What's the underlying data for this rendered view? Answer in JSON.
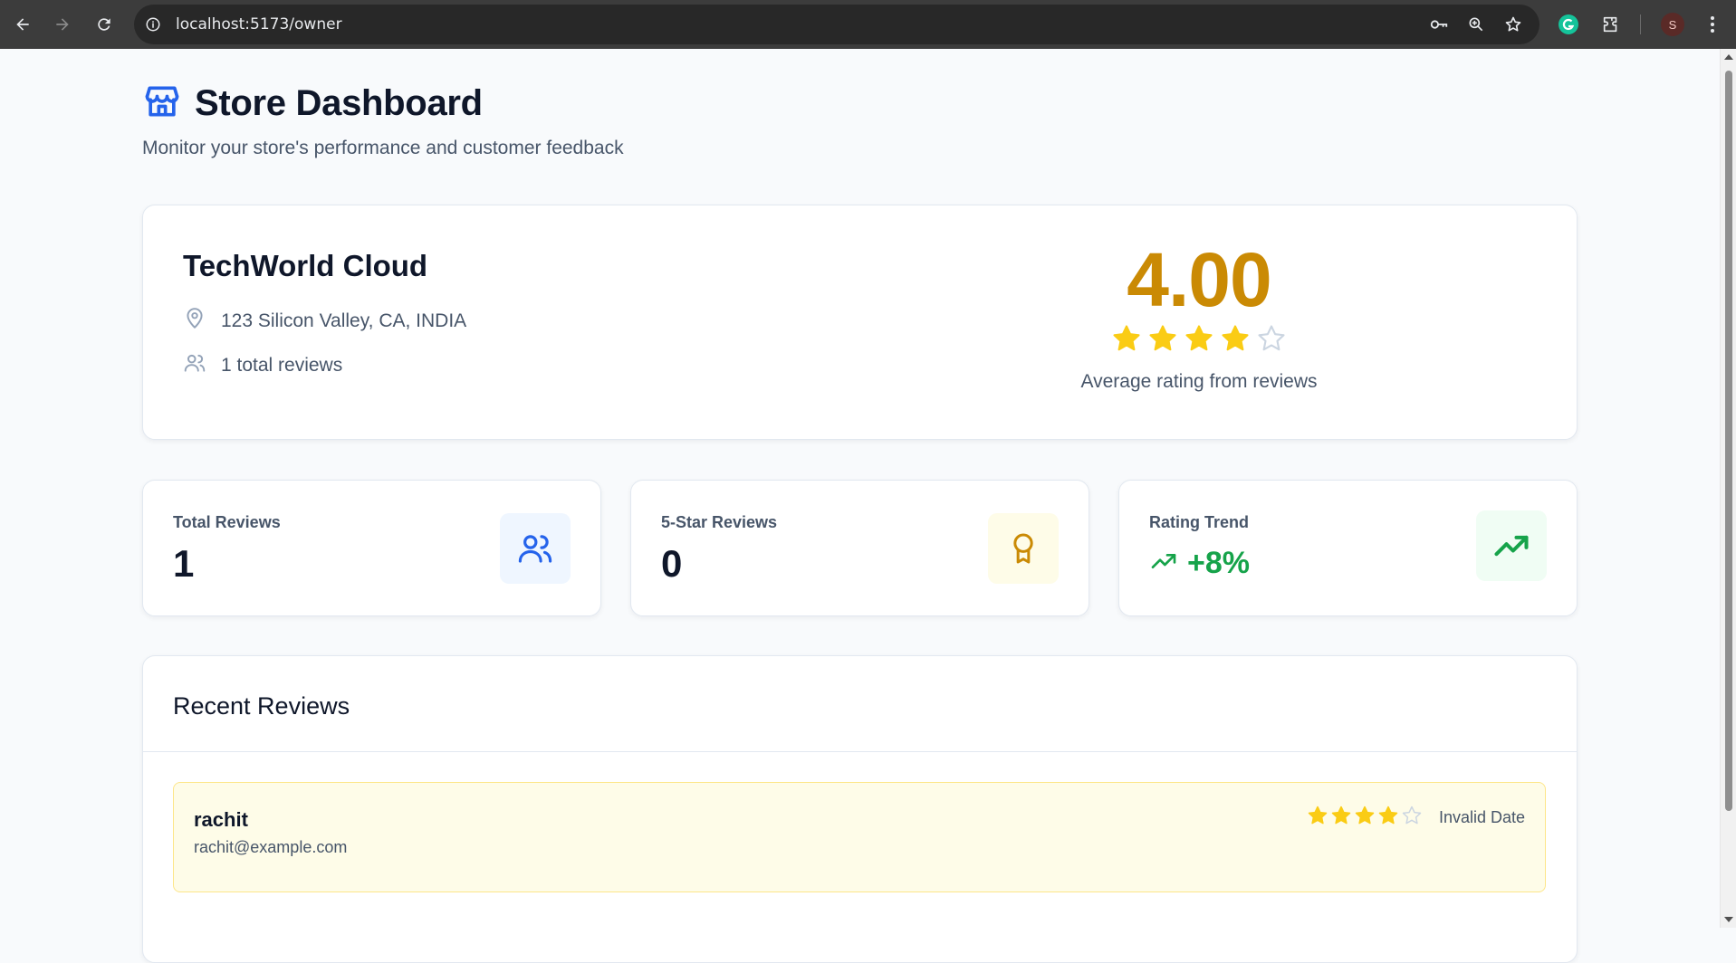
{
  "browser": {
    "url": "localhost:5173/owner",
    "profile_initial": "S"
  },
  "header": {
    "title": "Store Dashboard",
    "subtitle": "Monitor your store's performance and customer feedback",
    "icon": "store-icon"
  },
  "store": {
    "name": "TechWorld Cloud",
    "address": "123 Silicon Valley, CA, INDIA",
    "reviews_text": "1 total reviews",
    "average_rating": "4.00",
    "stars_filled": 4,
    "stars_total": 5,
    "rating_caption": "Average rating from reviews"
  },
  "stats": [
    {
      "label": "Total Reviews",
      "value": "1",
      "icon": "users-icon",
      "color": "#2563eb"
    },
    {
      "label": "5-Star Reviews",
      "value": "0",
      "icon": "award-icon",
      "color": "#ca8a04"
    },
    {
      "label": "Rating Trend",
      "value": "+8%",
      "icon": "trending-up-icon",
      "color": "#16a34a"
    }
  ],
  "recent_reviews": {
    "title": "Recent Reviews",
    "items": [
      {
        "name": "rachit",
        "email": "rachit@example.com",
        "stars_filled": 4,
        "date": "Invalid Date"
      }
    ]
  },
  "colors": {
    "accent": "#ca8a04",
    "primary": "#2563eb",
    "success": "#16a34a",
    "star": "#facc15"
  }
}
